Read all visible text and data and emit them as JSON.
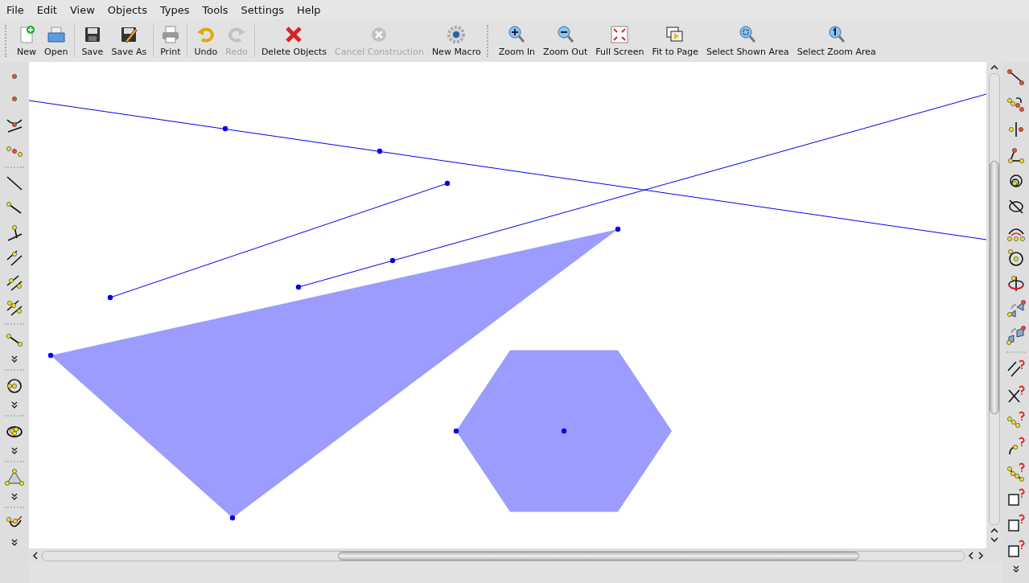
{
  "menu": [
    "File",
    "Edit",
    "View",
    "Objects",
    "Types",
    "Tools",
    "Settings",
    "Help"
  ],
  "toolbar": [
    [
      {
        "label": "New",
        "disabled": false
      },
      {
        "label": "Open",
        "disabled": false
      }
    ],
    [
      {
        "label": "Save",
        "disabled": false
      },
      {
        "label": "Save As",
        "disabled": false
      }
    ],
    [
      {
        "label": "Print",
        "disabled": false
      }
    ],
    [
      {
        "label": "Undo",
        "disabled": false
      },
      {
        "label": "Redo",
        "disabled": true
      }
    ],
    [
      {
        "label": "Delete Objects",
        "disabled": false
      },
      {
        "label": "Cancel Construction",
        "disabled": true
      },
      {
        "label": "New Macro",
        "disabled": false
      }
    ],
    [
      {
        "label": "Zoom In",
        "disabled": false
      },
      {
        "label": "Zoom Out",
        "disabled": false
      },
      {
        "label": "Full Screen",
        "disabled": false
      },
      {
        "label": "Fit to Page",
        "disabled": false
      },
      {
        "label": "Select Shown Area",
        "disabled": false
      },
      {
        "label": "Select Zoom Area",
        "disabled": false
      }
    ]
  ]
}
